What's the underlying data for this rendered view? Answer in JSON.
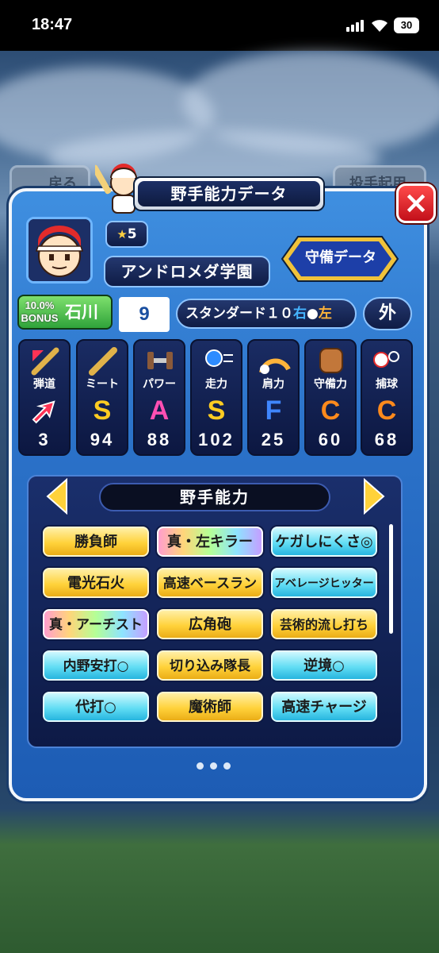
{
  "status_bar": {
    "time": "18:47",
    "battery": "30"
  },
  "background": {
    "back_button": "戻る",
    "right_button": "投手起用"
  },
  "panel": {
    "title": "野手能力データ",
    "close_label": "×",
    "rank_stars": "5",
    "school": "アンドロメダ学園",
    "defense_button": "守備データ",
    "bonus_text": "10.0%\nBONUS",
    "player_name": "石川",
    "uniform_number": "9",
    "batting_form": "スタンダード１０",
    "bats_right": "右",
    "bats_left": "左",
    "position": "外"
  },
  "stats": [
    {
      "label": "弾道",
      "grade": "",
      "value": "3",
      "color": "#ff3355",
      "icon": "trajectory-icon"
    },
    {
      "label": "ミート",
      "grade": "S",
      "value": "94",
      "color": "#ffcc22",
      "icon": "bat-icon"
    },
    {
      "label": "パワー",
      "grade": "A",
      "value": "88",
      "color": "#ff4fb3",
      "icon": "dumbbell-icon"
    },
    {
      "label": "走力",
      "grade": "S",
      "value": "102",
      "color": "#ffcc22",
      "icon": "running-ball-icon"
    },
    {
      "label": "肩力",
      "grade": "F",
      "value": "25",
      "color": "#3f86ff",
      "icon": "throw-arc-icon"
    },
    {
      "label": "守備力",
      "grade": "C",
      "value": "60",
      "color": "#ff8a1c",
      "icon": "glove-icon"
    },
    {
      "label": "捕球",
      "grade": "C",
      "value": "68",
      "color": "#ff8a1c",
      "icon": "catch-ball-icon"
    }
  ],
  "abilities": {
    "title": "野手能力",
    "items": [
      [
        "勝負師",
        "真・左キラー",
        "ケガしにくさ◎"
      ],
      [
        "電光石火",
        "高速ベースラン",
        "アベレージヒッター"
      ],
      [
        "真・アーチスト",
        "広角砲",
        "芸術的流し打ち"
      ],
      [
        "内野安打○",
        "切り込み隊長",
        "逆境○"
      ],
      [
        "代打○",
        "魔術師",
        "高速チャージ"
      ]
    ]
  }
}
